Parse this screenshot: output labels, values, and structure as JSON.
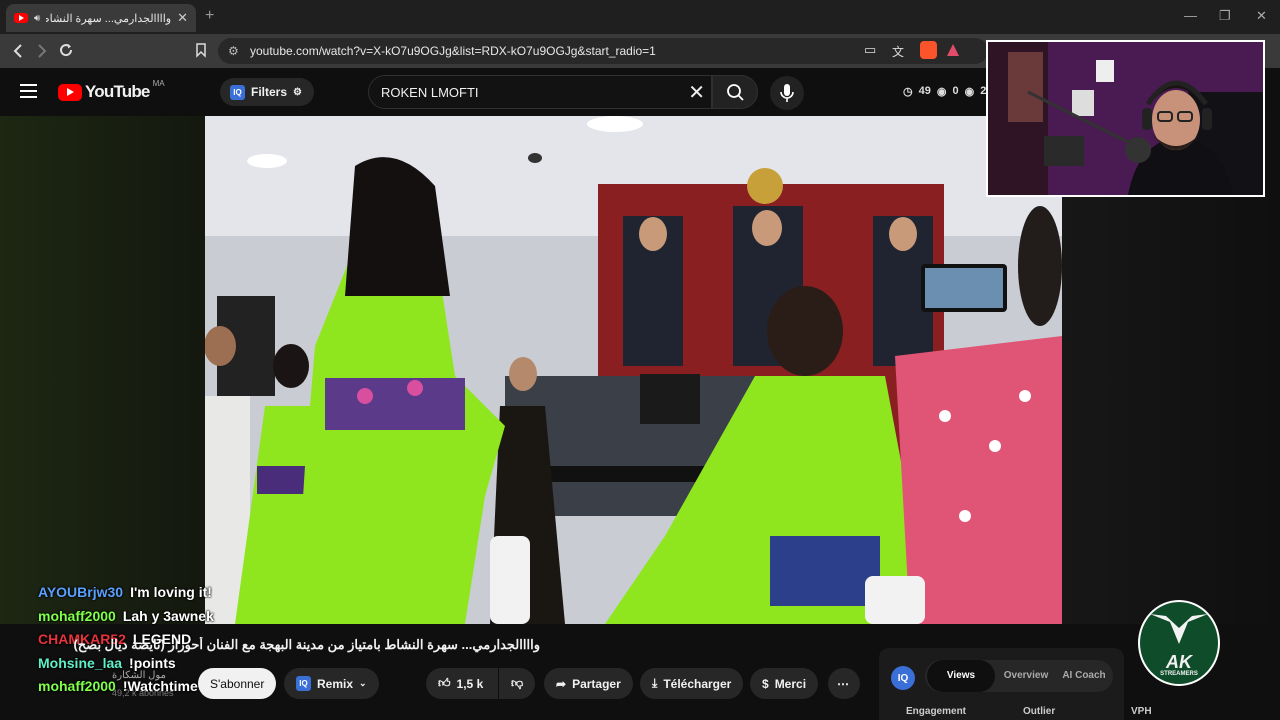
{
  "browser": {
    "tab_title": "واااالجدارمي... سهرة النشاط بامتياز",
    "tab_close": "✕",
    "new_tab": "+",
    "url": "youtube.com/watch?v=X-kO7u9OGJg&list=RDX-kO7u9OGJg&start_radio=1"
  },
  "youtube": {
    "logo_text": "YouTube",
    "region": "MA",
    "filters_label": "Filters",
    "iq_badge": "IQ",
    "search_value": "ROKEN LMOFTI",
    "stats": {
      "a": "49",
      "b": "0",
      "c": "2"
    }
  },
  "chat": [
    {
      "user": "AYOUBrjw30",
      "text": "I'm loving it!",
      "color": "#5aa0ff"
    },
    {
      "user": "mohaff2000",
      "text": "Lah y 3awnek",
      "color": "#7fff4a"
    },
    {
      "user": "CHAMKAR52",
      "text": "LEGEND",
      "color": "#e8323c"
    },
    {
      "user": "Mohsine_laa",
      "text": "!points",
      "color": "#5ff0c8"
    },
    {
      "user": "mohaff2000",
      "text": "!Watchtime",
      "color": "#7fff4a"
    }
  ],
  "video": {
    "title": "واااالجدارمي... سهرة النشاط بامتياز من مدينة البهجة مع الفنان أحوزار (نايضة ديال بصح)",
    "channel_name": "مول الشكارة",
    "subscribers": "49,2 k abonnés",
    "subscribe_label": "S'abonner",
    "remix_label": "Remix",
    "likes": "1,5 k",
    "share_label": "Partager",
    "download_label": "Télécharger",
    "thanks_label": "Merci",
    "more": "⋯"
  },
  "iq_panel": {
    "badge": "IQ",
    "tabs": [
      "Views",
      "Overview",
      "AI Coach"
    ],
    "active_tab": "Views",
    "sub_labels": [
      "Engagement",
      "Outlier",
      "VPH"
    ]
  },
  "overlay_logo": {
    "title": "AK",
    "subtitle": "STREAMERS"
  },
  "colors": {
    "accent": "#ff0000",
    "dress_green": "#8fe61f",
    "webcam_bg": "#4a1a52"
  }
}
